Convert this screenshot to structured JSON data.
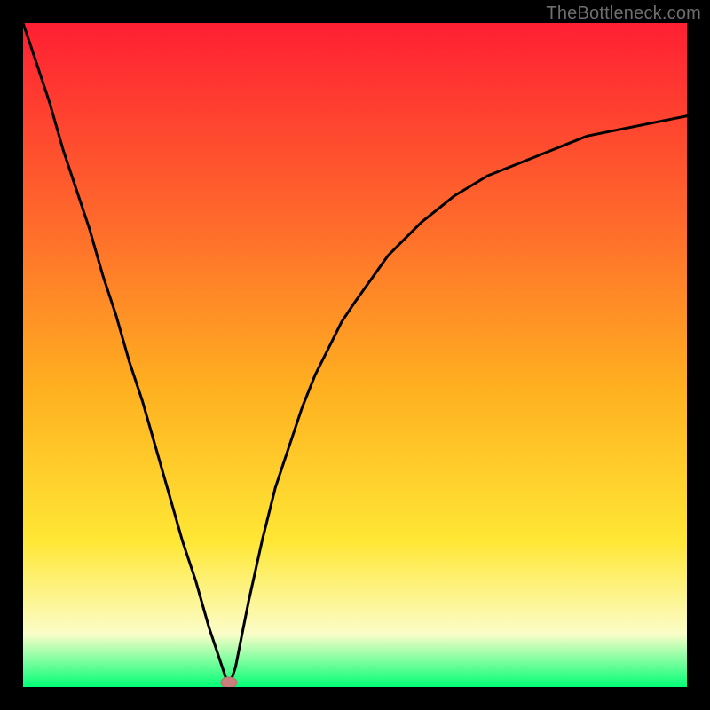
{
  "watermark": "TheBottleneck.com",
  "colors": {
    "frame": "#000000",
    "curve": "#000000",
    "marker_fill": "#cb7f7c",
    "marker_stroke": "#b86d6a",
    "gradient": {
      "top": "#ff1f33",
      "mid1": "#ff6a2c",
      "mid2": "#ffb020",
      "mid3": "#ffe735",
      "pale": "#fbfdc8",
      "green": "#03ff76"
    }
  },
  "chart_data": {
    "type": "line",
    "title": "",
    "xlabel": "",
    "ylabel": "",
    "x": [
      0.0,
      0.02,
      0.04,
      0.06,
      0.08,
      0.1,
      0.12,
      0.14,
      0.16,
      0.18,
      0.2,
      0.22,
      0.24,
      0.26,
      0.28,
      0.3,
      0.31,
      0.32,
      0.33,
      0.34,
      0.36,
      0.38,
      0.4,
      0.42,
      0.44,
      0.46,
      0.48,
      0.5,
      0.55,
      0.6,
      0.65,
      0.7,
      0.75,
      0.8,
      0.85,
      0.9,
      0.95,
      1.0
    ],
    "values": [
      1.0,
      0.94,
      0.88,
      0.81,
      0.75,
      0.69,
      0.62,
      0.56,
      0.49,
      0.43,
      0.36,
      0.29,
      0.22,
      0.16,
      0.09,
      0.03,
      0.0,
      0.03,
      0.08,
      0.13,
      0.22,
      0.3,
      0.36,
      0.42,
      0.47,
      0.51,
      0.55,
      0.58,
      0.65,
      0.7,
      0.74,
      0.77,
      0.79,
      0.81,
      0.83,
      0.84,
      0.85,
      0.86
    ],
    "xlim": [
      0,
      1
    ],
    "ylim": [
      0,
      1
    ],
    "marker": {
      "x": 0.31,
      "y": 0.0
    },
    "note": "x and y are normalized to [0,1]; y=0 is minimum (green band), y=1 is maximum (red top). Values read approximately from pixel positions; chart has no numeric axis labels."
  }
}
